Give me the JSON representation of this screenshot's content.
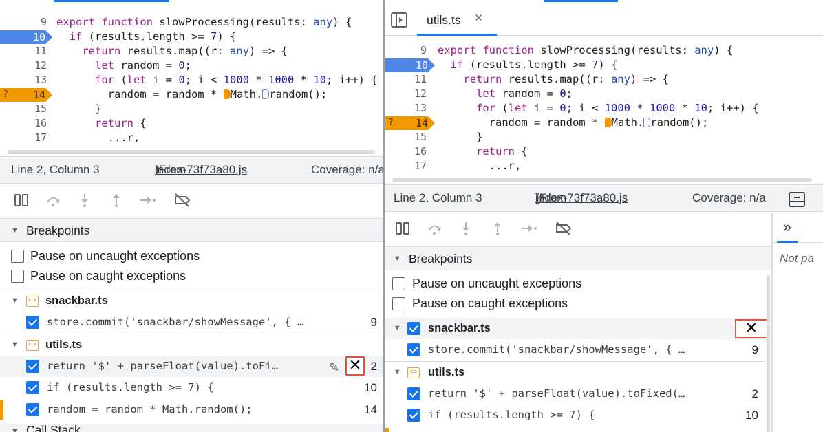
{
  "left": {
    "code_lines": [
      {
        "no": "9",
        "code": "export function slowProcessing(results: any) {"
      },
      {
        "no": "10",
        "code": "  if (results.length >= 7) {"
      },
      {
        "no": "11",
        "code": "    return results.map((r: any) => {"
      },
      {
        "no": "12",
        "code": "      let random = 0;"
      },
      {
        "no": "13",
        "code": "      for (let i = 0; i < 1000 * 1000 * 10; i++) {"
      },
      {
        "no": "14",
        "code_pre": "        random = random * ",
        "code_mid": "Math.",
        "code_post": "random();"
      },
      {
        "no": "15",
        "code": "      }"
      },
      {
        "no": "16",
        "code": "      return {"
      },
      {
        "no": "17",
        "code": "        ...r,"
      }
    ],
    "bp_marker_active": {
      "line": "10"
    },
    "bp_marker_conditional": {
      "line": "14",
      "cond": "?"
    },
    "status": {
      "position": "Line 2, Column 3",
      "from_pre": "(From ",
      "from_file": "index-73f73a80.js",
      "from_post": ")",
      "coverage": "Coverage: n/a"
    },
    "breakpoints_title": "Breakpoints",
    "pause_uncaught": "Pause on uncaught exceptions",
    "pause_caught": "Pause on caught exceptions",
    "files": [
      {
        "name": "snackbar.ts",
        "items": [
          {
            "code": "store.commit('snackbar/showMessage', { …",
            "line": "9"
          }
        ]
      },
      {
        "name": "utils.ts",
        "items": [
          {
            "code": "return '$' + parseFloat(value).toFi…",
            "line": "2"
          },
          {
            "code": "if (results.length >= 7) {",
            "line": "10"
          },
          {
            "code": "random = random * Math.random();",
            "line": "14"
          }
        ]
      }
    ],
    "call_stack_title": "Call Stack"
  },
  "right": {
    "tab_label": "utils.ts",
    "code_lines": [
      {
        "no": "9",
        "code": "export function slowProcessing(results: any) {"
      },
      {
        "no": "10",
        "code": "  if (results.length >= 7) {"
      },
      {
        "no": "11",
        "code": "    return results.map((r: any) => {"
      },
      {
        "no": "12",
        "code": "      let random = 0;"
      },
      {
        "no": "13",
        "code": "      for (let i = 0; i < 1000 * 1000 * 10; i++) {"
      },
      {
        "no": "14",
        "code_pre": "        random = random * ",
        "code_mid": "Math.",
        "code_post": "random();"
      },
      {
        "no": "15",
        "code": "      }"
      },
      {
        "no": "16",
        "code": "      return {"
      },
      {
        "no": "17",
        "code": "        ...r,"
      }
    ],
    "bp_marker_active": {
      "line": "10"
    },
    "bp_marker_conditional": {
      "line": "14",
      "cond": "?"
    },
    "status": {
      "position": "Line 2, Column 3",
      "from_pre": "(From ",
      "from_file": "index-73f73a80.js",
      "from_post": ")",
      "coverage": "Coverage: n/a"
    },
    "breakpoints_title": "Breakpoints",
    "pause_uncaught": "Pause on uncaught exceptions",
    "pause_caught": "Pause on caught exceptions",
    "files": [
      {
        "name": "snackbar.ts",
        "items": [
          {
            "code": "store.commit('snackbar/showMessage', { …",
            "line": "9"
          }
        ]
      },
      {
        "name": "utils.ts",
        "items": [
          {
            "code": "return '$' + parseFloat(value).toFixed(…",
            "line": "2"
          },
          {
            "code": "if (results.length >= 7) {",
            "line": "10"
          }
        ]
      }
    ],
    "side_text": "Not pa",
    "more_tabs": "»"
  },
  "colors": {
    "breakpoint_blue": "#4f86e8",
    "breakpoint_orange": "#f29900",
    "checkbox_blue": "#1a73e8",
    "highlight_red": "#e0533e"
  }
}
